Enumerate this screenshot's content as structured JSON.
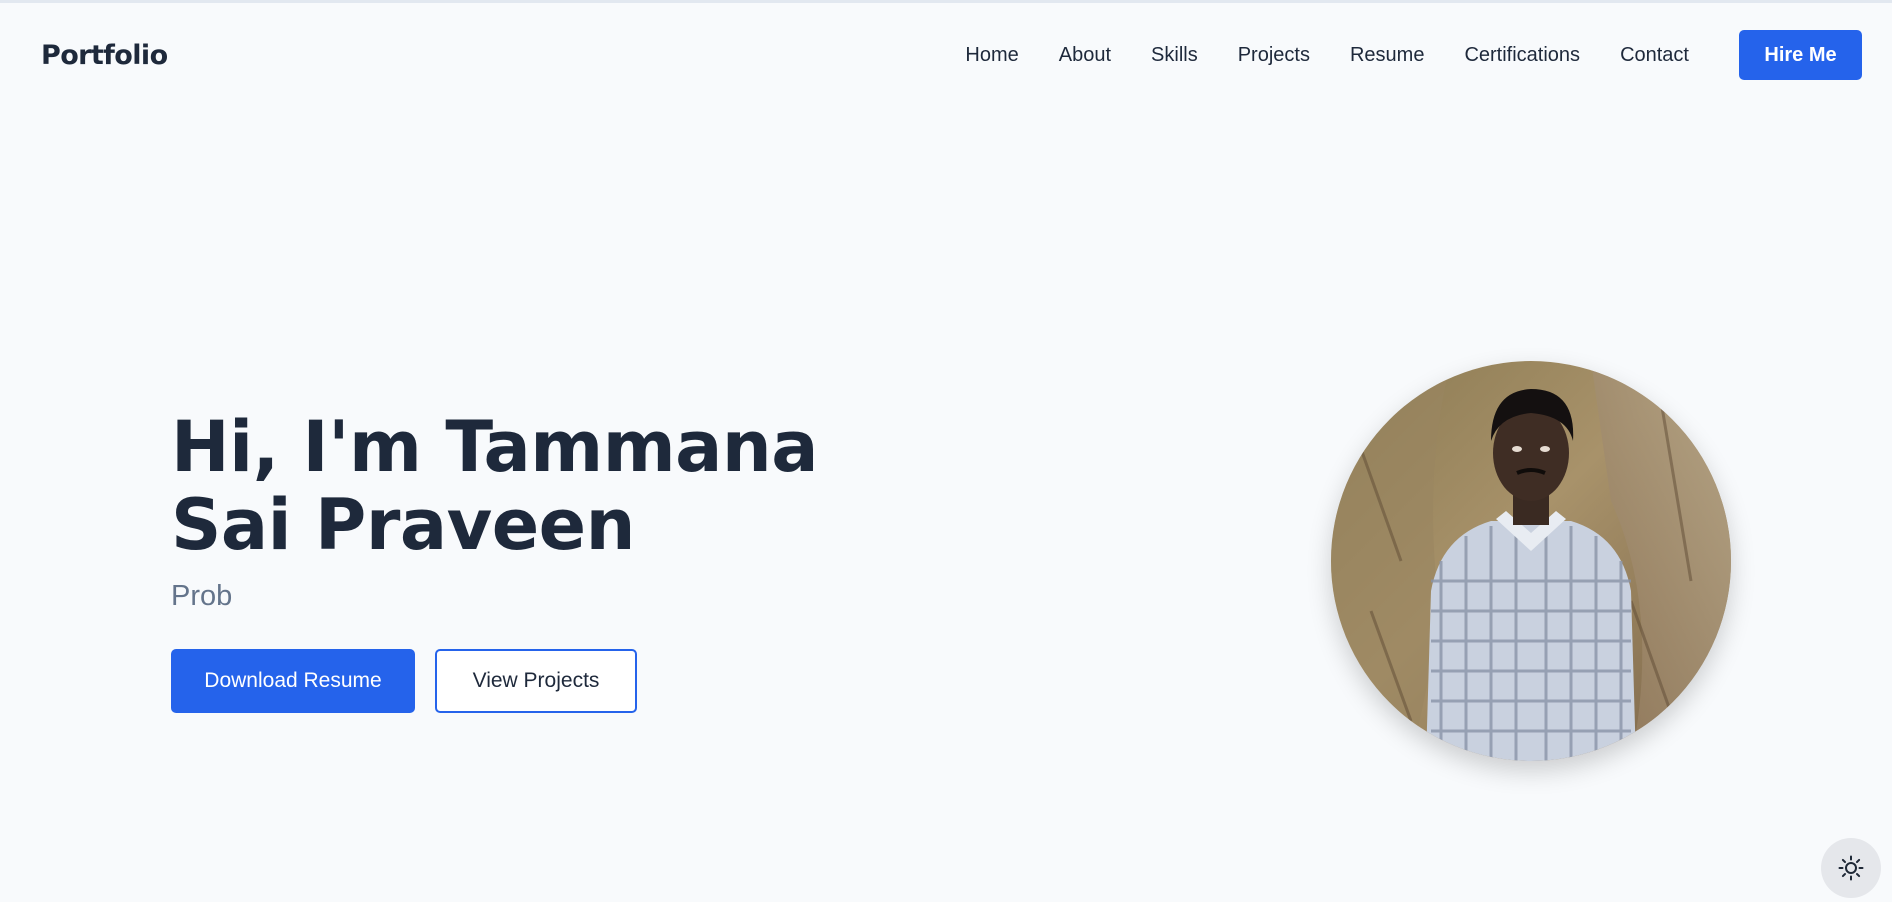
{
  "header": {
    "logo": "Portfolio",
    "nav": [
      "Home",
      "About",
      "Skills",
      "Projects",
      "Resume",
      "Certifications",
      "Contact"
    ],
    "cta_label": "Hire Me"
  },
  "hero": {
    "title": "Hi, I'm Tammana Sai Praveen",
    "subtitle": "Prob",
    "primary_button": "Download Resume",
    "secondary_button": "View Projects"
  },
  "icons": {
    "theme_toggle": "sun-icon",
    "avatar": "profile-photo"
  },
  "colors": {
    "accent": "#2563eb",
    "background": "#f8fafc",
    "text": "#1e293b",
    "muted": "#64748b"
  }
}
